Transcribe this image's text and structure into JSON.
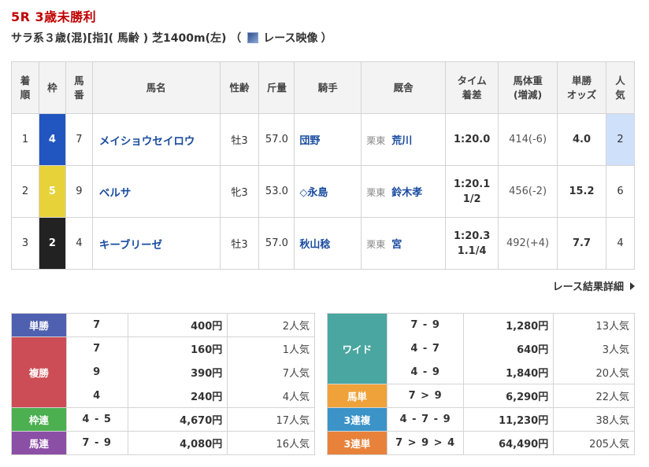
{
  "race": {
    "title": "5R 3歳未勝利",
    "conditions": "サラ系３歳(混)[指](  馬齢  )  芝1400m(左)  （",
    "video_label": "レース映像",
    "close_paren": "）"
  },
  "results": {
    "headers": {
      "rank": "着\n順",
      "waku": "枠",
      "umaban": "馬\n番",
      "name": "馬名",
      "sexage": "性齢",
      "kinryo": "斤量",
      "jockey": "騎手",
      "trainer": "厩舎",
      "time": "タイム\n着差",
      "weight": "馬体重\n(増減)",
      "odds": "単勝\nオッズ",
      "pop": "人\n気"
    },
    "rows": [
      {
        "rank": "1",
        "waku": "4",
        "umaban": "7",
        "name": "メイショウセイロウ",
        "sexage": "牡3",
        "kinryo": "57.0",
        "jockey": "団野",
        "area": "栗東",
        "trainer": "荒川",
        "time": "1:20.0",
        "margin": "",
        "weight": "414(-6)",
        "odds": "4.0",
        "pop": "2"
      },
      {
        "rank": "2",
        "waku": "5",
        "umaban": "9",
        "name": "ベルサ",
        "sexage": "牝3",
        "kinryo": "53.0",
        "jockey": "◇永島",
        "area": "栗東",
        "trainer": "鈴木孝",
        "time": "1:20.1",
        "margin": "1/2",
        "weight": "456(-2)",
        "odds": "15.2",
        "pop": "6"
      },
      {
        "rank": "3",
        "waku": "2",
        "umaban": "4",
        "name": "キーブリーゼ",
        "sexage": "牡3",
        "kinryo": "57.0",
        "jockey": "秋山稔",
        "area": "栗東",
        "trainer": "宮",
        "time": "1:20.3",
        "margin": "1.1/4",
        "weight": "492(+4)",
        "odds": "7.7",
        "pop": "4"
      }
    ]
  },
  "more_link": "レース結果詳細",
  "payouts_left": {
    "tansho": {
      "label": "単勝",
      "combos": [
        "7"
      ],
      "amounts": [
        "400円"
      ],
      "pops": [
        "2人気"
      ]
    },
    "fukusho": {
      "label": "複勝",
      "combos": [
        "7",
        "9",
        "4"
      ],
      "amounts": [
        "160円",
        "390円",
        "240円"
      ],
      "pops": [
        "1人気",
        "7人気",
        "4人気"
      ]
    },
    "wakuren": {
      "label": "枠連",
      "combos": [
        "4 - 5"
      ],
      "amounts": [
        "4,670円"
      ],
      "pops": [
        "17人気"
      ]
    },
    "umaren": {
      "label": "馬連",
      "combos": [
        "7 - 9"
      ],
      "amounts": [
        "4,080円"
      ],
      "pops": [
        "16人気"
      ]
    }
  },
  "payouts_right": {
    "wide": {
      "label": "ワイド",
      "combos": [
        "7 - 9",
        "4 - 7",
        "4 - 9"
      ],
      "amounts": [
        "1,280円",
        "640円",
        "1,840円"
      ],
      "pops": [
        "13人気",
        "3人気",
        "20人気"
      ]
    },
    "umatan": {
      "label": "馬単",
      "combos": [
        "7 > 9"
      ],
      "amounts": [
        "6,290円"
      ],
      "pops": [
        "22人気"
      ]
    },
    "sanrenpuku": {
      "label": "3連複",
      "combos": [
        "4 - 7 - 9"
      ],
      "amounts": [
        "11,230円"
      ],
      "pops": [
        "38人気"
      ]
    },
    "sanrentan": {
      "label": "3連単",
      "combos": [
        "7 > 9 > 4"
      ],
      "amounts": [
        "64,490円"
      ],
      "pops": [
        "205人気"
      ]
    }
  },
  "colors": {
    "title_red": "#c00000",
    "link_blue": "#1a4ca0",
    "waku4": "#2155c0",
    "waku5": "#e8d23a",
    "waku2": "#222222",
    "tansho": "#4f60b0",
    "fukusho": "#cc4d56",
    "wakuren": "#4caf50",
    "umaren": "#8b4fa6",
    "wide": "#4aa6a0",
    "umatan": "#f0a23a",
    "sanrenpuku": "#3b93c8",
    "sanrentan": "#e8823a"
  }
}
